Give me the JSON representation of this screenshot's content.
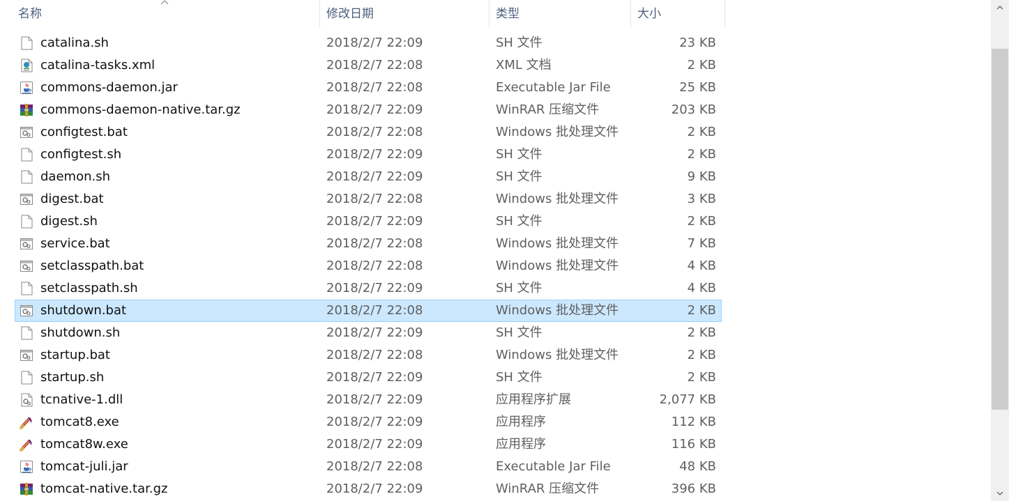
{
  "header": {
    "name": "名称",
    "date": "修改日期",
    "type": "类型",
    "size": "大小",
    "sorted_column": "name",
    "sort_icon": "sort-ascending-icon"
  },
  "colors": {
    "selection_background": "#cce8ff",
    "selection_border": "#99d1ff",
    "header_text": "#4c607a",
    "secondary_text": "#5f5f5f"
  },
  "files": [
    {
      "name": "catalina.sh",
      "date": "2018/2/7 22:09",
      "type": "SH 文件",
      "size": "23 KB",
      "icon": "blank-file-icon"
    },
    {
      "name": "catalina-tasks.xml",
      "date": "2018/2/7 22:08",
      "type": "XML 文档",
      "size": "2 KB",
      "icon": "xml-file-icon"
    },
    {
      "name": "commons-daemon.jar",
      "date": "2018/2/7 22:08",
      "type": "Executable Jar File",
      "size": "25 KB",
      "icon": "java-jar-icon"
    },
    {
      "name": "commons-daemon-native.tar.gz",
      "date": "2018/2/7 22:09",
      "type": "WinRAR 压缩文件",
      "size": "203 KB",
      "icon": "winrar-archive-icon"
    },
    {
      "name": "configtest.bat",
      "date": "2018/2/7 22:08",
      "type": "Windows 批处理文件",
      "size": "2 KB",
      "icon": "batch-file-icon"
    },
    {
      "name": "configtest.sh",
      "date": "2018/2/7 22:09",
      "type": "SH 文件",
      "size": "2 KB",
      "icon": "blank-file-icon"
    },
    {
      "name": "daemon.sh",
      "date": "2018/2/7 22:09",
      "type": "SH 文件",
      "size": "9 KB",
      "icon": "blank-file-icon"
    },
    {
      "name": "digest.bat",
      "date": "2018/2/7 22:08",
      "type": "Windows 批处理文件",
      "size": "3 KB",
      "icon": "batch-file-icon"
    },
    {
      "name": "digest.sh",
      "date": "2018/2/7 22:09",
      "type": "SH 文件",
      "size": "2 KB",
      "icon": "blank-file-icon"
    },
    {
      "name": "service.bat",
      "date": "2018/2/7 22:08",
      "type": "Windows 批处理文件",
      "size": "7 KB",
      "icon": "batch-file-icon"
    },
    {
      "name": "setclasspath.bat",
      "date": "2018/2/7 22:08",
      "type": "Windows 批处理文件",
      "size": "4 KB",
      "icon": "batch-file-icon"
    },
    {
      "name": "setclasspath.sh",
      "date": "2018/2/7 22:09",
      "type": "SH 文件",
      "size": "4 KB",
      "icon": "blank-file-icon"
    },
    {
      "name": "shutdown.bat",
      "date": "2018/2/7 22:08",
      "type": "Windows 批处理文件",
      "size": "2 KB",
      "icon": "batch-file-icon",
      "selected": true
    },
    {
      "name": "shutdown.sh",
      "date": "2018/2/7 22:09",
      "type": "SH 文件",
      "size": "2 KB",
      "icon": "blank-file-icon"
    },
    {
      "name": "startup.bat",
      "date": "2018/2/7 22:08",
      "type": "Windows 批处理文件",
      "size": "2 KB",
      "icon": "batch-file-icon"
    },
    {
      "name": "startup.sh",
      "date": "2018/2/7 22:09",
      "type": "SH 文件",
      "size": "2 KB",
      "icon": "blank-file-icon"
    },
    {
      "name": "tcnative-1.dll",
      "date": "2018/2/7 22:09",
      "type": "应用程序扩展",
      "size": "2,077 KB",
      "icon": "dll-file-icon"
    },
    {
      "name": "tomcat8.exe",
      "date": "2018/2/7 22:09",
      "type": "应用程序",
      "size": "112 KB",
      "icon": "tomcat-exe-icon"
    },
    {
      "name": "tomcat8w.exe",
      "date": "2018/2/7 22:09",
      "type": "应用程序",
      "size": "116 KB",
      "icon": "tomcat-exe-icon"
    },
    {
      "name": "tomcat-juli.jar",
      "date": "2018/2/7 22:08",
      "type": "Executable Jar File",
      "size": "48 KB",
      "icon": "java-jar-icon"
    },
    {
      "name": "tomcat-native.tar.gz",
      "date": "2018/2/7 22:09",
      "type": "WinRAR 压缩文件",
      "size": "396 KB",
      "icon": "winrar-archive-icon"
    }
  ]
}
